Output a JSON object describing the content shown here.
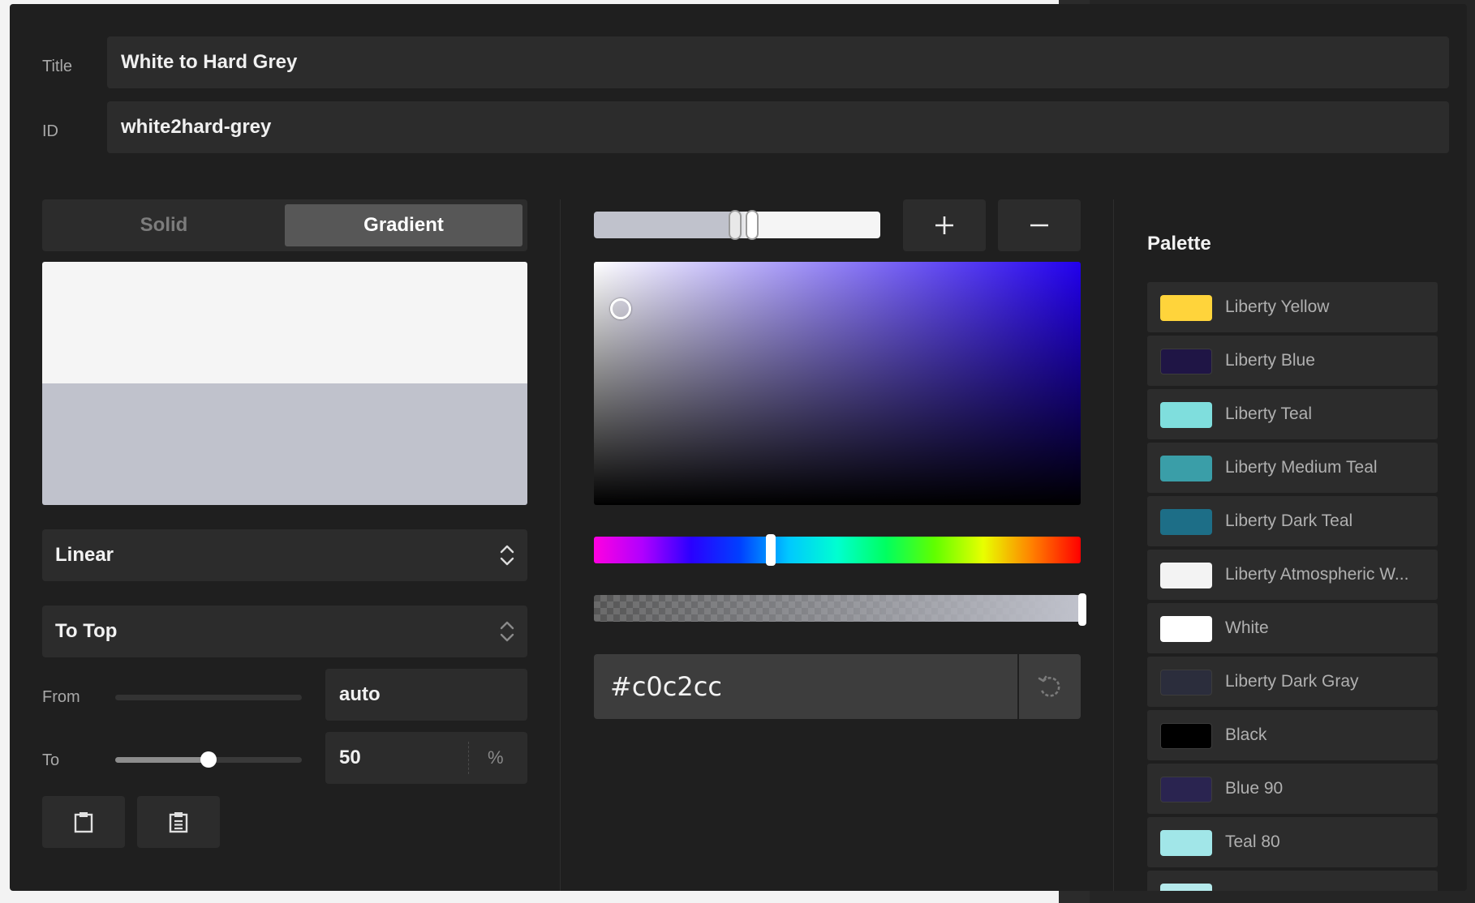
{
  "form": {
    "title_label": "Title",
    "title_value": "White to Hard Grey",
    "id_label": "ID",
    "id_value": "white2hard-grey"
  },
  "mode": {
    "solid_label": "Solid",
    "gradient_label": "Gradient",
    "active": "Gradient"
  },
  "gradient": {
    "preview_colors": [
      "#f5f5f5",
      "#c0c2cc"
    ],
    "type_select": "Linear",
    "direction_select": "To Top",
    "from_label": "From",
    "from_value": "auto",
    "to_label": "To",
    "to_value": "50",
    "to_unit": "%",
    "to_fraction": 0.5
  },
  "actions": {
    "copy_icon": "clipboard-icon",
    "paste_icon": "clipboard-list-icon"
  },
  "picker": {
    "add_icon": "plus-icon",
    "remove_icon": "minus-icon",
    "hex_value": "#c0c2cc",
    "reset_icon": "rotate-ccw-icon",
    "accent": "#2200ee"
  },
  "palette": {
    "title": "Palette",
    "items": [
      {
        "name": "Liberty Yellow",
        "color": "#ffd43b"
      },
      {
        "name": "Liberty Blue",
        "color": "#1f1545"
      },
      {
        "name": "Liberty Teal",
        "color": "#7fdedd"
      },
      {
        "name": "Liberty Medium Teal",
        "color": "#3a9ea8"
      },
      {
        "name": "Liberty Dark Teal",
        "color": "#1d6e87"
      },
      {
        "name": "Liberty Atmospheric W...",
        "color": "#f3f3f3"
      },
      {
        "name": "White",
        "color": "#ffffff"
      },
      {
        "name": "Liberty Dark Gray",
        "color": "#2b2d3c"
      },
      {
        "name": "Black",
        "color": "#000000"
      },
      {
        "name": "Blue 90",
        "color": "#2a2450"
      },
      {
        "name": "Teal 80",
        "color": "#a1e6e8"
      },
      {
        "name": "",
        "color": "#b5eaec"
      }
    ]
  }
}
